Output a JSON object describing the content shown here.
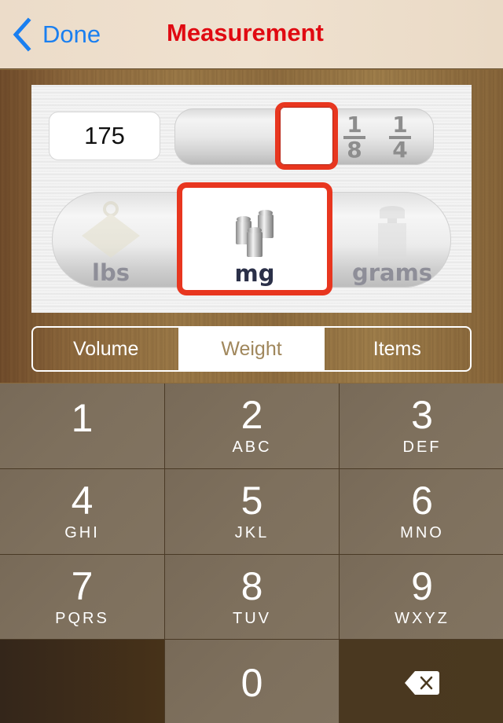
{
  "navbar": {
    "back_label": "Done",
    "title": "Measurement",
    "back_color": "#1a7ff0",
    "title_color": "#e00a12"
  },
  "measurement": {
    "amount": "175",
    "fraction_options": [
      {
        "label": "",
        "selected": true
      },
      {
        "numerator": "1",
        "denominator": "8",
        "selected": false
      },
      {
        "numerator": "1",
        "denominator": "4",
        "selected": false
      }
    ],
    "unit_options": [
      {
        "label": "lbs",
        "icon": "weight-lbs-icon",
        "selected": false
      },
      {
        "label": "mg",
        "icon": "weights-mg-icon",
        "selected": true
      },
      {
        "label": "grams",
        "icon": "weight-grams-icon",
        "selected": false
      }
    ],
    "selection_color": "#e8361f"
  },
  "segmented": {
    "tabs": [
      {
        "label": "Volume",
        "selected": false
      },
      {
        "label": "Weight",
        "selected": true
      },
      {
        "label": "Items",
        "selected": false
      }
    ]
  },
  "keypad": {
    "keys": [
      {
        "digit": "1",
        "letters": ""
      },
      {
        "digit": "2",
        "letters": "ABC"
      },
      {
        "digit": "3",
        "letters": "DEF"
      },
      {
        "digit": "4",
        "letters": "GHI"
      },
      {
        "digit": "5",
        "letters": "JKL"
      },
      {
        "digit": "6",
        "letters": "MNO"
      },
      {
        "digit": "7",
        "letters": "PQRS"
      },
      {
        "digit": "8",
        "letters": "TUV"
      },
      {
        "digit": "9",
        "letters": "WXYZ"
      },
      {
        "digit": "0",
        "letters": ""
      }
    ],
    "delete_icon": "backspace-icon"
  }
}
